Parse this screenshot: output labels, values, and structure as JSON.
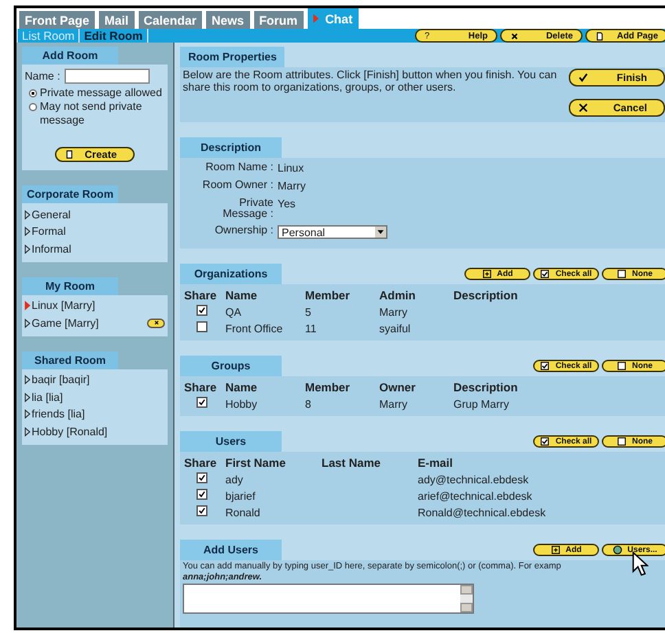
{
  "top_tabs": [
    {
      "label": "Front Page",
      "selected": false
    },
    {
      "label": "Mail",
      "selected": false
    },
    {
      "label": "Calendar",
      "selected": false
    },
    {
      "label": "News",
      "selected": false
    },
    {
      "label": "Forum",
      "selected": false
    },
    {
      "label": "Chat",
      "selected": true
    }
  ],
  "subnav": [
    {
      "label": "List Room",
      "selected": false
    },
    {
      "label": "Edit Room",
      "selected": true
    }
  ],
  "toolbar_buttons": [
    {
      "label": "Help",
      "kind": "help",
      "icon": "?"
    },
    {
      "label": "Delete",
      "kind": "delete"
    },
    {
      "label": "Add Page",
      "kind": "page"
    }
  ],
  "sidebar": {
    "add_room": {
      "title": "Add Room",
      "name_label": "Name :",
      "options": [
        {
          "label": "Private message allowed",
          "selected": true
        },
        {
          "label": "May not send private message",
          "selected": false
        }
      ],
      "create_button": "Create"
    },
    "sections": [
      {
        "title": "Corporate Room",
        "items": [
          {
            "label": "General",
            "selected": false
          },
          {
            "label": "Formal",
            "selected": false
          },
          {
            "label": "Informal",
            "selected": false
          }
        ]
      },
      {
        "title": "My Room",
        "items": [
          {
            "label": "Linux [Marry]",
            "selected": true
          },
          {
            "label": "Game [Marry]",
            "selected": false,
            "removable": true
          }
        ]
      },
      {
        "title": "Shared Room",
        "items": [
          {
            "label": "baqir [baqir]",
            "selected": false
          },
          {
            "label": "lia [lia]",
            "selected": false
          },
          {
            "label": "friends [lia]",
            "selected": false
          },
          {
            "label": "Hobby [Ronald]",
            "selected": false
          }
        ]
      }
    ]
  },
  "room_properties": {
    "title": "Room Properties",
    "text": "Below are the Room attributes. Click [Finish] button when you finish. You can share this room to organizations, groups, or other users.",
    "buttons": [
      {
        "label": "Finish",
        "kind": "finish"
      },
      {
        "label": "Cancel",
        "kind": "cancel"
      }
    ]
  },
  "description": {
    "title": "Description",
    "fields": [
      {
        "label": "Room Name :",
        "value": "Linux",
        "kind": "text"
      },
      {
        "label": "Room Owner :",
        "value": "Marry",
        "kind": "text"
      },
      {
        "label": "Private Message :",
        "value": "Yes",
        "kind": "text"
      },
      {
        "label": "Ownership :",
        "value": "Personal",
        "kind": "select"
      }
    ]
  },
  "tables": [
    {
      "title": "Organizations",
      "buttons": [
        {
          "label": "Add",
          "kind": "add"
        },
        {
          "label": "Check all",
          "kind": "check"
        },
        {
          "label": "None",
          "kind": "none"
        }
      ],
      "columns": [
        "Share",
        "Name",
        "Member",
        "Admin",
        "Description"
      ],
      "rows": [
        {
          "checked": true,
          "cells": [
            "",
            "QA",
            "5",
            "Marry"
          ]
        },
        {
          "checked": false,
          "cells": [
            "",
            "Front Office",
            "11",
            "syaiful"
          ]
        }
      ]
    },
    {
      "title": "Groups",
      "buttons": [
        {
          "label": "Check all",
          "kind": "check"
        },
        {
          "label": "None",
          "kind": "none"
        }
      ],
      "columns": [
        "Share",
        "Name",
        "Member",
        "Owner",
        "Description"
      ],
      "rows": [
        {
          "checked": true,
          "cells": [
            "",
            "Hobby",
            "8",
            "Marry",
            "Grup Marry"
          ]
        }
      ]
    },
    {
      "title": "Users",
      "buttons": [
        {
          "label": "Check all",
          "kind": "check"
        },
        {
          "label": "None",
          "kind": "none"
        }
      ],
      "columns": [
        "Share",
        "First Name",
        "Last Name",
        "E-mail"
      ],
      "rows": [
        {
          "checked": true,
          "cells": [
            "",
            "ady",
            "",
            "ady@technical.ebdesk"
          ]
        },
        {
          "checked": true,
          "cells": [
            "",
            "bjarief",
            "",
            "arief@technical.ebdesk"
          ]
        },
        {
          "checked": true,
          "cells": [
            "",
            "Ronald",
            "",
            "Ronald@technical.ebdesk"
          ]
        }
      ]
    }
  ],
  "add_users": {
    "title": "Add Users",
    "buttons": [
      {
        "label": "Add",
        "kind": "add"
      },
      {
        "label": "Users...",
        "kind": "users"
      }
    ],
    "hint": "You can add manually by typing user_ID here, separate by semicolon(;) or (comma). For examp",
    "example": "anna;john;andrew."
  }
}
